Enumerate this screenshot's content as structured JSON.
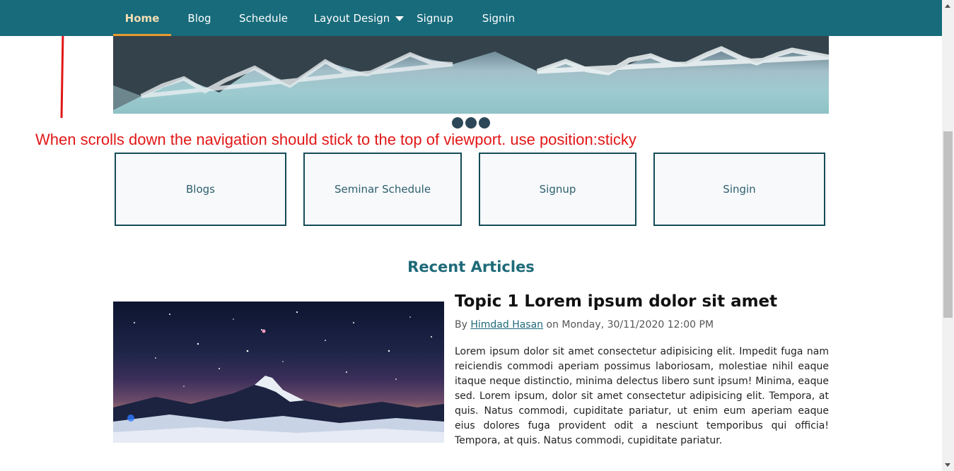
{
  "nav": {
    "items": [
      {
        "label": "Home",
        "active": true
      },
      {
        "label": "Blog"
      },
      {
        "label": "Schedule"
      },
      {
        "label": "Layout Design",
        "icon": "caret-down-icon"
      },
      {
        "label": "Signup"
      },
      {
        "label": "Signin"
      }
    ]
  },
  "annotation": {
    "text": "When scrolls down the navigation should stick to the top of viewport. use position:sticky",
    "color": "#e11717"
  },
  "slider": {
    "dots": 3
  },
  "cards": [
    {
      "label": "Blogs"
    },
    {
      "label": "Seminar Schedule"
    },
    {
      "label": "Signup"
    },
    {
      "label": "Singin"
    }
  ],
  "recent": {
    "title": "Recent Articles",
    "article": {
      "title": "Topic 1 Lorem ipsum dolor sit amet",
      "by": "By",
      "author": "Himdad Hasan",
      "date": "on Monday, 30/11/2020 12:00 PM",
      "body": "Lorem ipsum dolor sit amet consectetur adipisicing elit. Impedit fuga nam reiciendis commodi aperiam possimus laboriosam, molestiae nihil eaque itaque neque distinctio, minima delectus libero sunt ipsum! Minima, eaque sed. Lorem ipsum, dolor sit amet consectetur adipisicing elit. Tempora, at quis. Natus commodi, cupiditate pariatur, ut enim eum aperiam eaque eius dolores fuga provident odit a nesciunt temporibus qui officia! Tempora, at quis. Natus commodi, cupiditate pariatur."
    }
  },
  "colors": {
    "nav_bg": "#176b7b",
    "active_underline": "#e89a2f",
    "card_border": "#154c58",
    "section_title": "#1e6a79"
  }
}
